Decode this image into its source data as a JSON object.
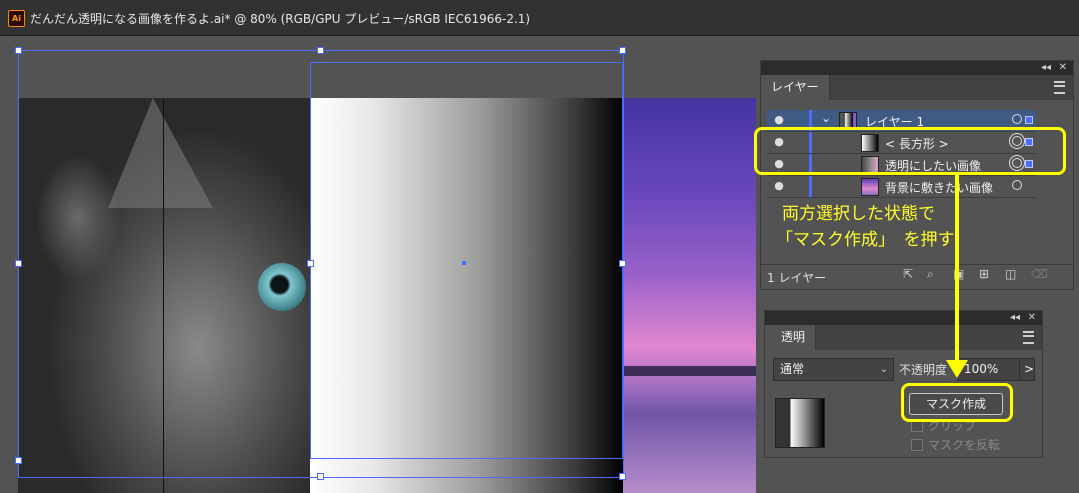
{
  "window": {
    "app_icon": "Ai",
    "document_title": "だんだん透明になる画像を作るよ.ai* @ 80% (RGB/GPU プレビュー/sRGB IEC61966-2.1)"
  },
  "layers_panel": {
    "tab_label": "レイヤー",
    "collapse_icon": "◂◂",
    "close_icon": "✕",
    "layers": [
      {
        "name": "レイヤー 1",
        "expand_icon": "⌄"
      },
      {
        "name": "< 長方形 >"
      },
      {
        "name": "透明にしたい画像"
      },
      {
        "name": "背景に敷きたい画像"
      }
    ],
    "footer_count": "1 レイヤー"
  },
  "transparency_panel": {
    "tab_label": "透明",
    "blend_mode": "通常",
    "opacity_label": "不透明度",
    "opacity_value": "100%",
    "opacity_arrow": ">",
    "make_mask_button": "マスク作成",
    "clip_label": "クリップ",
    "invert_mask_label": "マスクを反転"
  },
  "annotation": {
    "line1": "両方選択した状態で",
    "line2": "「マスク作成」　を押す",
    "color": "#ffff00"
  }
}
